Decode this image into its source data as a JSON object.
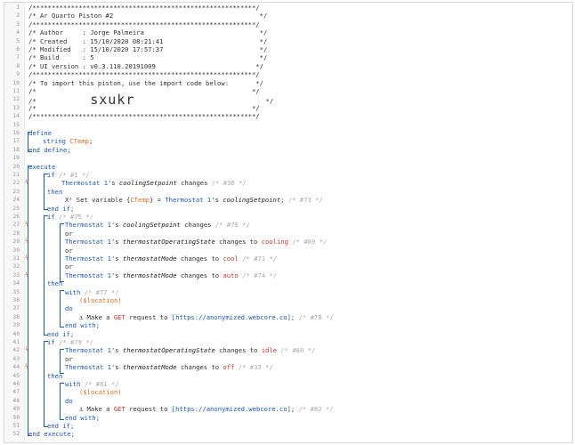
{
  "header": {
    "border_top": "/**********************************************************/",
    "title": "/* Ar Quarto Piston #2                                      */",
    "border_mid": "/**********************************************************/",
    "author": "/* Author     : Jorge Palmeira                              */",
    "created": "/* Created    : 15/10/2020 08:21:41                         */",
    "modified": "/* Modified   : 15/10/2020 17:57:37                         */",
    "build": "/* Build      : 5                                           */",
    "ui_version": "/* UI version : v0.3.110.20191009                          */",
    "border_mid2": "/**********************************************************/",
    "import_note": "/* To import this piston, use the import code below:       */",
    "blank_a": "/*                                                        */",
    "import_code_prefix": "/*              ",
    "import_code": "sxukr",
    "import_code_suffix": "                                  */",
    "blank_b": "/*                                                        */",
    "border_bottom": "/**********************************************************/"
  },
  "define": {
    "keyword": "define",
    "var_type": "string",
    "var_name": "CTemp",
    "end": "end define;"
  },
  "execute": {
    "keyword": "execute",
    "end": "end execute;"
  },
  "kw": {
    "if": "if",
    "then": "then",
    "or": "or",
    "with": "with",
    "do": "do",
    "end_if": "end if;",
    "end_with": "end with;"
  },
  "block1": {
    "comment": "/* #1 */",
    "cond": {
      "device": "Thermostat 1",
      "attr": "coolingSetpoint",
      "op": "changes",
      "comment": "/* #36 */"
    },
    "action": {
      "text": "Set variable",
      "var": "CTemp",
      "device": "Thermostat 1",
      "attr": "coolingSetpoint",
      "comment": "/* #73 */"
    }
  },
  "block2": {
    "comment": "/* #75 */",
    "conds": [
      {
        "device": "Thermostat 1",
        "attr": "coolingSetpoint",
        "op": "changes",
        "value": "",
        "comment": "/* #76 */"
      },
      {
        "device": "Thermostat 1",
        "attr": "thermostatOperatingState",
        "op": "changes to",
        "value": "cooling",
        "comment": "/* #69 */"
      },
      {
        "device": "Thermostat 1",
        "attr": "thermostatMode",
        "op": "changes to",
        "value": "cool",
        "comment": "/* #71 */"
      },
      {
        "device": "Thermostat 1",
        "attr": "thermostatMode",
        "op": "changes to",
        "value": "auto",
        "comment": "/* #74 */"
      }
    ],
    "with_comment": "/* #77 */",
    "location": "($location)",
    "request": {
      "text": "Make a",
      "method": "GET",
      "mid": "request to",
      "url": "[https://anonymized.webcore.co]",
      "comment": "/* #78 */"
    }
  },
  "block3": {
    "comment": "/* #79 */",
    "conds": [
      {
        "device": "Thermostat 1",
        "attr": "thermostatOperatingState",
        "op": "changes to",
        "value": "idle",
        "comment": "/* #80 */"
      },
      {
        "device": "Thermostat 1",
        "attr": "thermostatMode",
        "op": "changes to",
        "value": "off",
        "comment": "/* #33 */"
      }
    ],
    "with_comment": "/* #81 */",
    "location": "($location)",
    "request": {
      "text": "Make a",
      "method": "GET",
      "mid": "request to",
      "url": "[https://anonymized.webcore.co]",
      "comment": "/* #82 */"
    }
  },
  "line_numbers": [
    "1",
    "2",
    "3",
    "4",
    "5",
    "6",
    "7",
    "8",
    "9",
    "10",
    "11",
    "12",
    "13",
    "14",
    "15",
    "16",
    "17",
    "18",
    "19",
    "20",
    "21",
    "22",
    "23",
    "24",
    "25",
    "26",
    "27",
    "28",
    "29",
    "30",
    "31",
    "32",
    "33",
    "34",
    "35",
    "36",
    "37",
    "38",
    "39",
    "40",
    "41",
    "42",
    "43",
    "44",
    "45",
    "46",
    "47",
    "48",
    "49",
    "50",
    "51",
    "52"
  ],
  "icons": {
    "trigger": "bolt-icon",
    "set_variable": "x-squared-icon",
    "web_request": "anchor-icon"
  },
  "colors": {
    "keyword": "#1d58b7",
    "variable": "#e06c1f",
    "trigger": "#e06c1f",
    "comment_dim": "#aaaaaa",
    "value": "#c0392b"
  }
}
